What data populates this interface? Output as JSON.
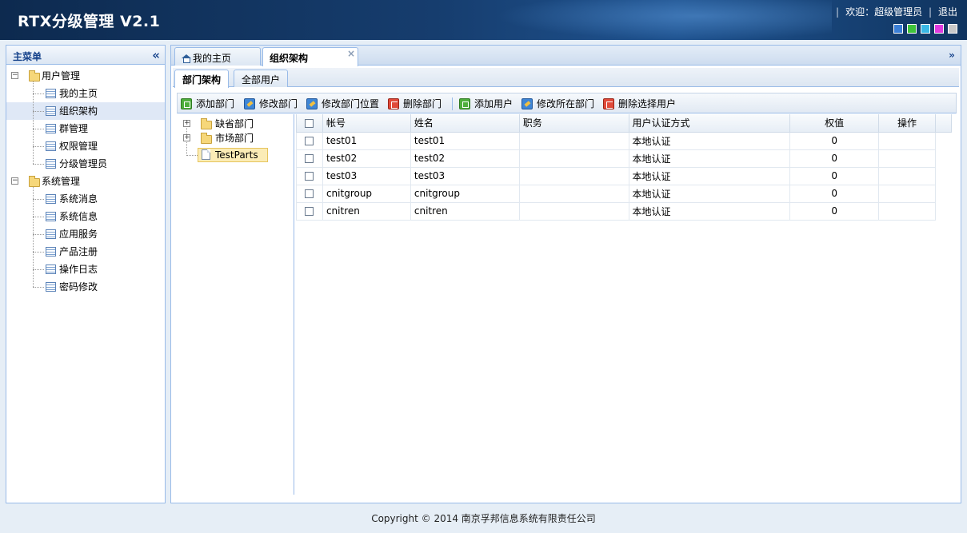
{
  "header": {
    "title": "RTX分级管理  V2.1",
    "welcome": "欢迎：超级管理员",
    "logout": "退出",
    "theme_colors": [
      "#3b7fd6",
      "#3fc43a",
      "#3ab8e6",
      "#e03adf",
      "#c8c8c8"
    ]
  },
  "sidebar": {
    "title": "主菜单",
    "groups": [
      {
        "label": "用户管理",
        "items": [
          "我的主页",
          "组织架构",
          "群管理",
          "权限管理",
          "分级管理员"
        ]
      },
      {
        "label": "系统管理",
        "items": [
          "系统消息",
          "系统信息",
          "应用服务",
          "产品注册",
          "操作日志",
          "密码修改"
        ]
      }
    ]
  },
  "tabs": {
    "home": "我的主页",
    "org": "组织架构"
  },
  "subtabs": {
    "dept": "部门架构",
    "users": "全部用户"
  },
  "toolbar": {
    "add_dept": "添加部门",
    "edit_dept": "修改部门",
    "move_dept": "修改部门位置",
    "delete_dept": "删除部门",
    "add_user": "添加用户",
    "edit_user_dept": "修改所在部门",
    "delete_users": "删除选择用户"
  },
  "dept_tree": [
    "缺省部门",
    "市场部门",
    "TestParts"
  ],
  "table": {
    "columns": [
      "帐号",
      "姓名",
      "职务",
      "用户认证方式",
      "权值",
      "操作"
    ],
    "rows": [
      {
        "account": "test01",
        "name": "test01",
        "title": "",
        "auth": "本地认证",
        "weight": "0",
        "op": ""
      },
      {
        "account": "test02",
        "name": "test02",
        "title": "",
        "auth": "本地认证",
        "weight": "0",
        "op": ""
      },
      {
        "account": "test03",
        "name": "test03",
        "title": "",
        "auth": "本地认证",
        "weight": "0",
        "op": ""
      },
      {
        "account": "cnitgroup",
        "name": "cnitgroup",
        "title": "",
        "auth": "本地认证",
        "weight": "0",
        "op": ""
      },
      {
        "account": "cnitren",
        "name": "cnitren",
        "title": "",
        "auth": "本地认证",
        "weight": "0",
        "op": ""
      }
    ]
  },
  "footer": {
    "copyright": "Copyright © 2014 南京孚邦信息系统有限责任公司"
  }
}
